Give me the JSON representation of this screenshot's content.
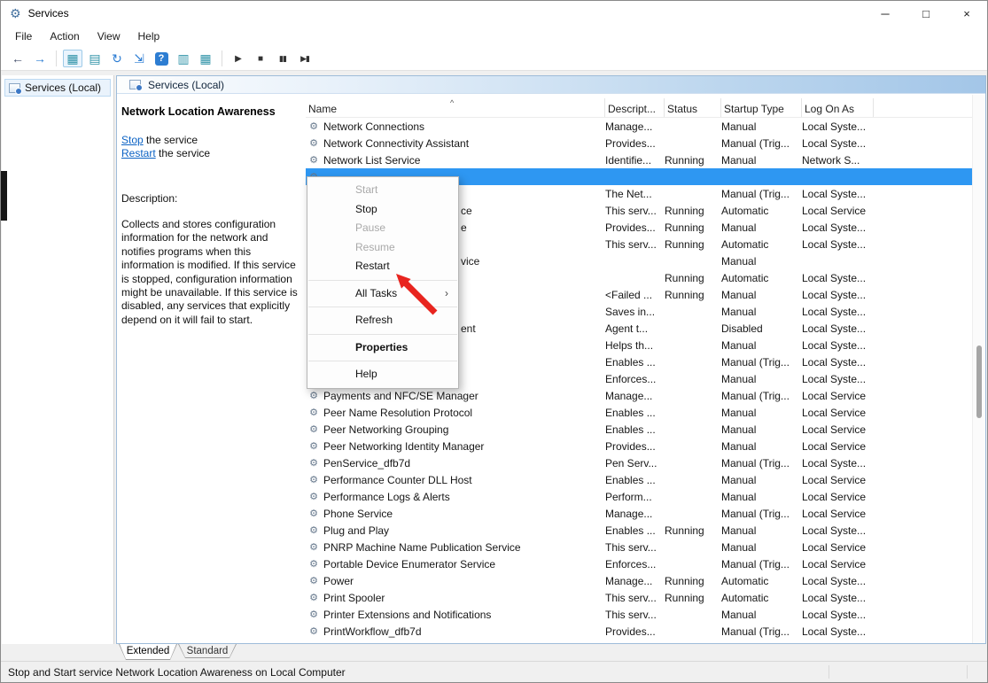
{
  "window": {
    "title": "Services",
    "minimize_glyph": "─",
    "maximize_glyph": "□",
    "close_glyph": "×"
  },
  "menu_bar": {
    "items": [
      "File",
      "Action",
      "View",
      "Help"
    ]
  },
  "toolbar": {
    "buttons": [
      {
        "name": "back-icon",
        "glyph": "←",
        "style": "dim"
      },
      {
        "name": "forward-icon",
        "glyph": "→",
        "style": "blue"
      },
      {
        "separator": true
      },
      {
        "name": "show-console-tree-icon",
        "glyph": "▦",
        "style": "teal active"
      },
      {
        "name": "export-list-icon",
        "glyph": "▤",
        "style": "teal"
      },
      {
        "name": "refresh-icon",
        "glyph": "↻",
        "style": "blue"
      },
      {
        "name": "save-list-icon",
        "glyph": "⇲",
        "style": "blue"
      },
      {
        "name": "help-icon",
        "glyph": "?",
        "style": "help"
      },
      {
        "name": "show-description-icon",
        "glyph": "▥",
        "style": "teal"
      },
      {
        "name": "standard-view-icon",
        "glyph": "▦",
        "style": "teal"
      },
      {
        "separator": true
      },
      {
        "name": "start-service-icon",
        "glyph": "▶",
        "style": "dark"
      },
      {
        "name": "stop-service-icon",
        "glyph": "■",
        "style": "dark"
      },
      {
        "name": "pause-service-icon",
        "glyph": "▮▮",
        "style": "dark small"
      },
      {
        "name": "restart-service-icon",
        "glyph": "▶▮",
        "style": "dark small"
      }
    ]
  },
  "tree": {
    "root_label": "Services (Local)"
  },
  "main_header": {
    "title": "Services (Local)"
  },
  "detail_pane": {
    "service_name": "Network Location Awareness",
    "stop_link": "Stop",
    "stop_suffix": " the service",
    "restart_link": "Restart",
    "restart_suffix": " the service",
    "description_label": "Description:",
    "description": "Collects and stores configuration information for the network and notifies programs when this information is modified. If this service is stopped, configuration information might be unavailable. If this service is disabled, any services that explicitly depend on it will fail to start."
  },
  "list": {
    "columns": [
      "Name",
      "Descript...",
      "Status",
      "Startup Type",
      "Log On As"
    ],
    "sort_indicator": "^",
    "row_icon": "⚙",
    "rows": [
      {
        "name": "Network Connections",
        "desc": "Manage...",
        "status": "",
        "startup": "Manual",
        "logon": "Local Syste..."
      },
      {
        "name": "Network Connectivity Assistant",
        "desc": "Provides...",
        "status": "",
        "startup": "Manual (Trig...",
        "logon": "Local Syste..."
      },
      {
        "name": "Network List Service",
        "desc": "Identifie...",
        "status": "Running",
        "startup": "Manual",
        "logon": "Network S..."
      },
      {
        "name": "",
        "desc": "",
        "status": "",
        "startup": "",
        "logon": "",
        "selected": true
      },
      {
        "name": "",
        "desc": "The Net...",
        "status": "",
        "startup": "Manual (Trig...",
        "logon": "Local Syste..."
      },
      {
        "name": "ce",
        "fragment": true,
        "desc": "This serv...",
        "status": "Running",
        "startup": "Automatic",
        "logon": "Local Service"
      },
      {
        "name": "e",
        "fragment": true,
        "desc": "Provides...",
        "status": "Running",
        "startup": "Manual",
        "logon": "Local Syste..."
      },
      {
        "name": "",
        "desc": "This serv...",
        "status": "Running",
        "startup": "Automatic",
        "logon": "Local Syste..."
      },
      {
        "name": "vice",
        "fragment": true,
        "desc": "",
        "status": "",
        "startup": "Manual",
        "logon": ""
      },
      {
        "name": "",
        "desc": "",
        "status": "Running",
        "startup": "Automatic",
        "logon": "Local Syste..."
      },
      {
        "name": "",
        "desc": "<Failed ...",
        "status": "Running",
        "startup": "Manual",
        "logon": "Local Syste..."
      },
      {
        "name": "",
        "desc": "Saves in...",
        "status": "",
        "startup": "Manual",
        "logon": "Local Syste..."
      },
      {
        "name": "ent",
        "fragment": true,
        "desc": "Agent t...",
        "status": "",
        "startup": "Disabled",
        "logon": "Local Syste..."
      },
      {
        "name": "",
        "desc": "Helps th...",
        "status": "",
        "startup": "Manual",
        "logon": "Local Syste..."
      },
      {
        "name": "",
        "desc": "Enables ...",
        "status": "",
        "startup": "Manual (Trig...",
        "logon": "Local Syste..."
      },
      {
        "name": "",
        "desc": "Enforces...",
        "status": "",
        "startup": "Manual",
        "logon": "Local Syste..."
      },
      {
        "name": "Payments and NFC/SE Manager",
        "desc": "Manage...",
        "status": "",
        "startup": "Manual (Trig...",
        "logon": "Local Service"
      },
      {
        "name": "Peer Name Resolution Protocol",
        "desc": "Enables ...",
        "status": "",
        "startup": "Manual",
        "logon": "Local Service"
      },
      {
        "name": "Peer Networking Grouping",
        "desc": "Enables ...",
        "status": "",
        "startup": "Manual",
        "logon": "Local Service"
      },
      {
        "name": "Peer Networking Identity Manager",
        "desc": "Provides...",
        "status": "",
        "startup": "Manual",
        "logon": "Local Service"
      },
      {
        "name": "PenService_dfb7d",
        "desc": "Pen Serv...",
        "status": "",
        "startup": "Manual (Trig...",
        "logon": "Local Syste..."
      },
      {
        "name": "Performance Counter DLL Host",
        "desc": "Enables ...",
        "status": "",
        "startup": "Manual",
        "logon": "Local Service"
      },
      {
        "name": "Performance Logs & Alerts",
        "desc": "Perform...",
        "status": "",
        "startup": "Manual",
        "logon": "Local Service"
      },
      {
        "name": "Phone Service",
        "desc": "Manage...",
        "status": "",
        "startup": "Manual (Trig...",
        "logon": "Local Service"
      },
      {
        "name": "Plug and Play",
        "desc": "Enables ...",
        "status": "Running",
        "startup": "Manual",
        "logon": "Local Syste..."
      },
      {
        "name": "PNRP Machine Name Publication Service",
        "desc": "This serv...",
        "status": "",
        "startup": "Manual",
        "logon": "Local Service"
      },
      {
        "name": "Portable Device Enumerator Service",
        "desc": "Enforces...",
        "status": "",
        "startup": "Manual (Trig...",
        "logon": "Local Service"
      },
      {
        "name": "Power",
        "desc": "Manage...",
        "status": "Running",
        "startup": "Automatic",
        "logon": "Local Syste..."
      },
      {
        "name": "Print Spooler",
        "desc": "This serv...",
        "status": "Running",
        "startup": "Automatic",
        "logon": "Local Syste..."
      },
      {
        "name": "Printer Extensions and Notifications",
        "desc": "This serv...",
        "status": "",
        "startup": "Manual",
        "logon": "Local Syste..."
      },
      {
        "name": "PrintWorkflow_dfb7d",
        "desc": "Provides...",
        "status": "",
        "startup": "Manual (Trig...",
        "logon": "Local Syste..."
      }
    ]
  },
  "context_menu": {
    "submenu_arrow": "›",
    "items": [
      {
        "label": "Start",
        "disabled": true
      },
      {
        "label": "Stop"
      },
      {
        "label": "Pause",
        "disabled": true
      },
      {
        "label": "Resume",
        "disabled": true
      },
      {
        "label": "Restart"
      },
      {
        "separator": true
      },
      {
        "label": "All Tasks",
        "submenu": true
      },
      {
        "separator": true
      },
      {
        "label": "Refresh"
      },
      {
        "separator": true
      },
      {
        "label": "Properties",
        "bold": true
      },
      {
        "separator": true
      },
      {
        "label": "Help"
      }
    ]
  },
  "tabs": [
    {
      "label": "Extended",
      "active": true
    },
    {
      "label": "Standard"
    }
  ],
  "status_bar": {
    "text": "Stop and Start service Network Location Awareness on Local Computer"
  },
  "colors": {
    "selection": "#2e97f2",
    "link": "#0b62c4",
    "arrow_red": "#e8251f"
  }
}
